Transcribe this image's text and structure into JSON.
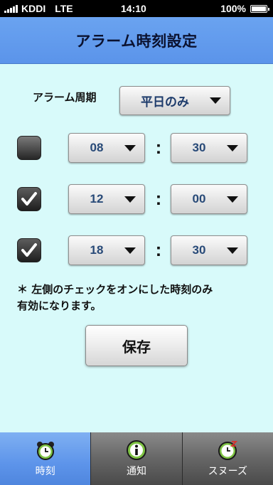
{
  "status_bar": {
    "carrier": "KDDI",
    "network": "LTE",
    "time": "14:10",
    "battery": "100%"
  },
  "header": {
    "title": "アラーム時刻設定"
  },
  "period": {
    "label": "アラーム周期",
    "value": "平日のみ"
  },
  "alarms": [
    {
      "enabled": false,
      "hour": "08",
      "minute": "30",
      "separator": ":"
    },
    {
      "enabled": true,
      "hour": "12",
      "minute": "00",
      "separator": ":"
    },
    {
      "enabled": true,
      "hour": "18",
      "minute": "30",
      "separator": ":"
    }
  ],
  "note": {
    "line1": "＊ 左側のチェックをオンにした時刻のみ",
    "line2": "有効になります。"
  },
  "save_button": {
    "label": "保存"
  },
  "tabs": [
    {
      "label": "時刻",
      "icon": "alarm-clock-icon",
      "active": true
    },
    {
      "label": "通知",
      "icon": "info-icon",
      "active": false
    },
    {
      "label": "スヌーズ",
      "icon": "snooze-clock-icon",
      "active": false
    }
  ],
  "colors": {
    "background": "#d8fafa",
    "header": "#5b94ea",
    "active_tab": "#5d94ea",
    "dropdown_text": "#284a78"
  }
}
